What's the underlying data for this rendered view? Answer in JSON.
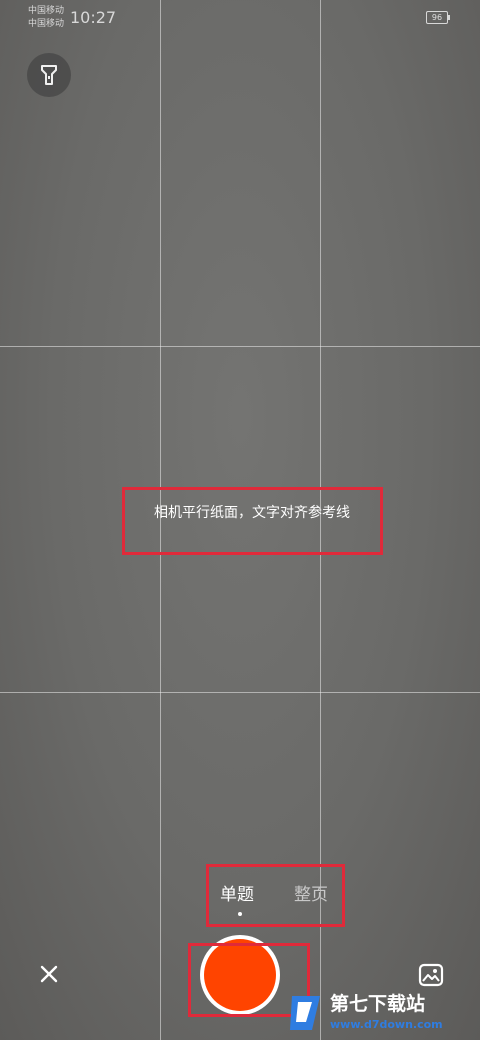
{
  "status_bar": {
    "carrier_1": "中国移动",
    "carrier_2": "中国移动",
    "time": "10:27",
    "battery": "96"
  },
  "toolbar": {
    "flash_icon": "flashlight-icon"
  },
  "viewfinder": {
    "hint": "相机平行纸面，文字对齐参考线",
    "grid": "3x3"
  },
  "modes": {
    "items": [
      {
        "label": "单题",
        "selected": true
      },
      {
        "label": "整页",
        "selected": false
      }
    ]
  },
  "controls": {
    "close_icon": "close-icon",
    "gallery_icon": "gallery-icon",
    "shutter_color": "#ff4400"
  },
  "annotation_color": "#e02a3a",
  "watermark": {
    "text": "第七下载站",
    "url": "www.d7down.com"
  }
}
